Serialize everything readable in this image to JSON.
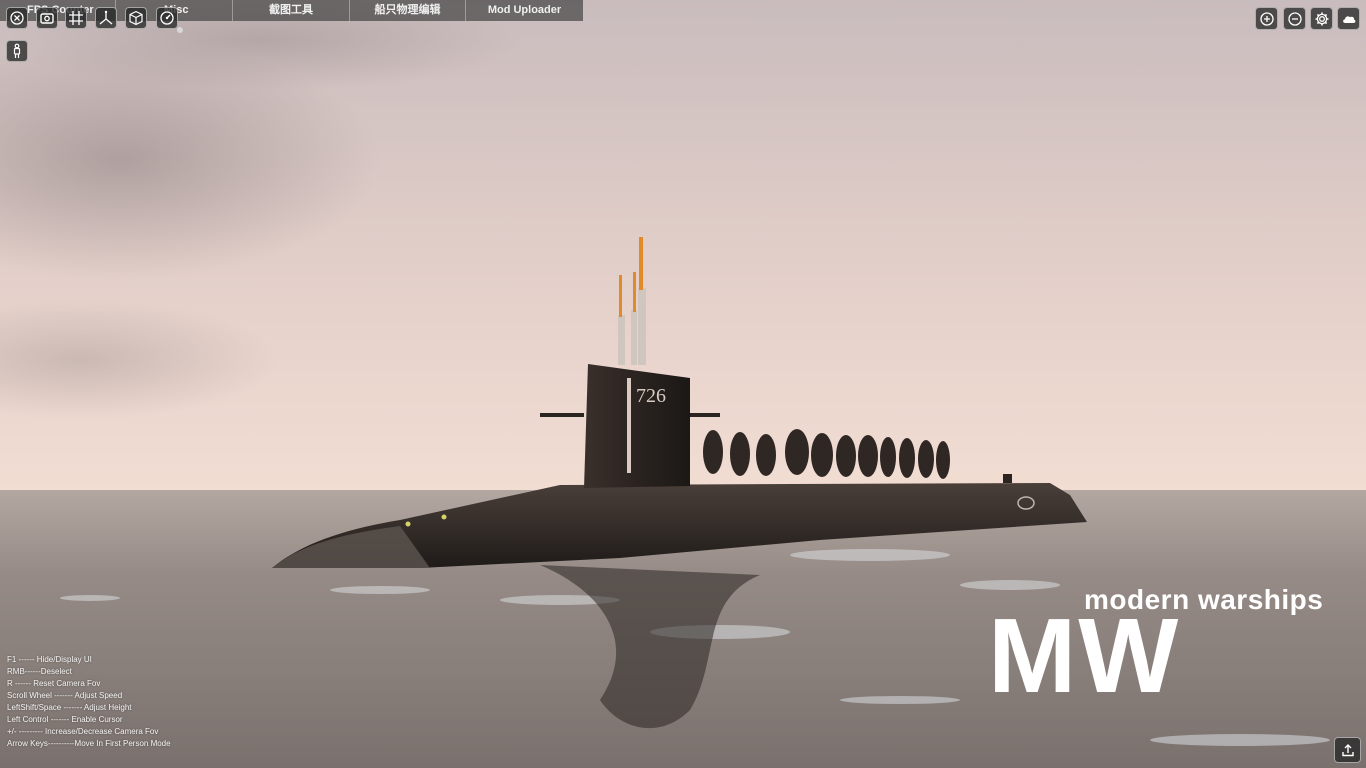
{
  "tabs": [
    {
      "label": "FPS Counter"
    },
    {
      "label": "Misc"
    },
    {
      "label": "截图工具"
    },
    {
      "label": "船只物理编辑"
    },
    {
      "label": "Mod Uploader"
    }
  ],
  "left_tools": [
    "close-icon",
    "camera-icon",
    "grid-icon",
    "axes-icon",
    "cube-icon",
    "gauge-icon",
    "person-icon"
  ],
  "right_tools": [
    "zoom-in-icon",
    "zoom-out-icon",
    "gear-icon",
    "cloud-icon"
  ],
  "hull_number": "726",
  "help_lines": [
    "F1 ------ Hide/Display UI",
    "RMB------Deselect",
    "R ------ Reset Camera Fov",
    "Scroll Wheel ------- Adjust Speed",
    "LeftShift/Space ------- Adjust Height",
    "Left Control ------- Enable Cursor",
    "+/- --------- Increase/Decrease Camera Fov",
    "Arrow Keys----------Move In First Person Mode"
  ],
  "logo": {
    "subtitle": "modern warships",
    "main": "MW"
  },
  "colors": {
    "sky_top": "#cfc0c1",
    "sky_horizon": "#efd8cf",
    "sea": "#8f8682",
    "hull": "#2b2522",
    "mast_tip": "#e08a2a"
  }
}
